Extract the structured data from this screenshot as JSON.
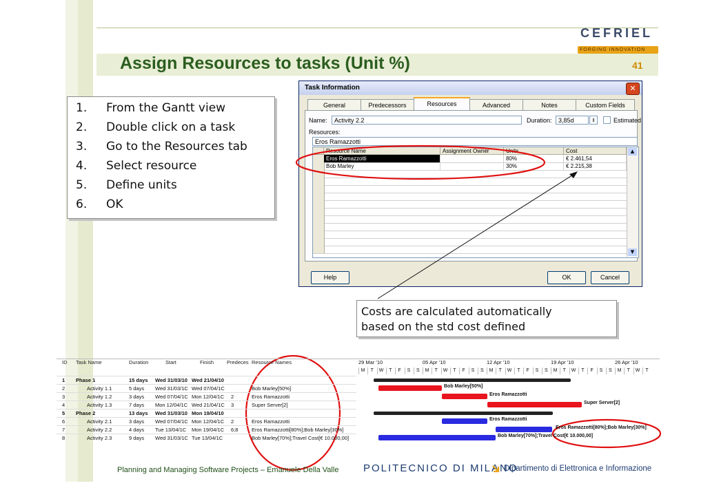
{
  "slide": {
    "title": "Assign Resources to tasks (Unit %)",
    "page_number": "41",
    "logo": {
      "name": "CEFRIEL",
      "tagline": "FORGING INNOVATION"
    },
    "footer": "Planning and Managing Software Projects – Emanuele Della Valle",
    "institution": "POLITECNICO DI MILANO",
    "department": "Dipartimento di Elettronica e Informazione"
  },
  "steps": [
    {
      "num": "1.",
      "text": "From the Gantt view"
    },
    {
      "num": "2.",
      "text": "Double click on a task"
    },
    {
      "num": "3.",
      "text": "Go to the Resources tab"
    },
    {
      "num": "4.",
      "text": "Select resource"
    },
    {
      "num": "5.",
      "text": "Define units"
    },
    {
      "num": "6.",
      "text": "OK"
    }
  ],
  "dialog": {
    "title": "Task Information",
    "close_glyph": "✕",
    "tabs": [
      "General",
      "Predecessors",
      "Resources",
      "Advanced",
      "Notes",
      "Custom Fields"
    ],
    "active_tab": "Resources",
    "name_label": "Name:",
    "name_value": "Activity 2.2",
    "duration_label": "Duration:",
    "duration_value": "3,85d",
    "estimated_label": "Estimated",
    "resources_label": "Resources:",
    "edit_value": "Eros Ramazzotti",
    "columns": [
      "Resource Name",
      "Assignment Owner",
      "Units",
      "Cost"
    ],
    "rows": [
      {
        "resource": "Eros Ramazzotti",
        "owner": "",
        "units": "80%",
        "cost": "€ 2.461,54"
      },
      {
        "resource": "Bob Marley",
        "owner": "",
        "units": "30%",
        "cost": "€ 2.215,38"
      }
    ],
    "help_label": "Help",
    "ok_label": "OK",
    "cancel_label": "Cancel"
  },
  "annotation": {
    "line1": "Costs are calculated automatically",
    "line2": "based on the std cost defined"
  },
  "gantt": {
    "headers": [
      "ID",
      "Task Name",
      "Duration",
      "Start",
      "Finish",
      "Predeces",
      "Resource Names"
    ],
    "weeks": [
      "29 Mar '10",
      "05 Apr '10",
      "12 Apr '10",
      "19 Apr '10",
      "26 Apr '10"
    ],
    "day_letters": [
      "M",
      "T",
      "W",
      "T",
      "F",
      "S",
      "S"
    ],
    "rows": [
      {
        "id": "1",
        "name": "Phase 1",
        "duration": "15 days",
        "start": "Wed 31/03/10",
        "finish": "Wed 21/04/10",
        "pred": "",
        "resources": ""
      },
      {
        "id": "2",
        "name": "Activity 1.1",
        "duration": "5 days",
        "start": "Wed 31/03/1C",
        "finish": "Wed 07/04/1C",
        "pred": "",
        "resources": "Bob Marley[50%]"
      },
      {
        "id": "3",
        "name": "Activity 1.2",
        "duration": "3 days",
        "start": "Wed 07/04/1C",
        "finish": "Mon 12/04/1C",
        "pred": "2",
        "resources": "Eros Ramazzotti"
      },
      {
        "id": "4",
        "name": "Activity 1.3",
        "duration": "7 days",
        "start": "Mon 12/04/1C",
        "finish": "Wed 21/04/1C",
        "pred": "3",
        "resources": "Super Server[2]"
      },
      {
        "id": "5",
        "name": "Phase 2",
        "duration": "13 days",
        "start": "Wed 31/03/10",
        "finish": "Mon 19/04/10",
        "pred": "",
        "resources": ""
      },
      {
        "id": "6",
        "name": "Activity 2.1",
        "duration": "3 days",
        "start": "Wed 07/04/1C",
        "finish": "Mon 12/04/1C",
        "pred": "2",
        "resources": "Eros Ramazzotti"
      },
      {
        "id": "7",
        "name": "Activity 2.2",
        "duration": "4 days",
        "start": "Tue 13/04/1C",
        "finish": "Mon 19/04/1C",
        "pred": "6;8",
        "resources": "Eros Ramazzotti[80%];Bob Marley[30%]"
      },
      {
        "id": "8",
        "name": "Activity 2.3",
        "duration": "9 days",
        "start": "Wed 31/03/1C",
        "finish": "Tue 13/04/1C",
        "pred": "",
        "resources": "Bob Marley[70%];Travel Cost[€ 10.000,00]"
      }
    ],
    "bar_labels": {
      "r2": "Bob Marley[50%]",
      "r3": "Eros Ramazzotti",
      "r4": "Super Server[2]",
      "r6": "Eros Ramazzotti",
      "r7": "Eros Ramazzotti[80%];Bob Marley[30%]",
      "r8": "Bob Marley[70%];Travel Cost[€ 10.000,00]"
    }
  },
  "colors": {
    "title": "#2b5d1f",
    "accent": "#d08a00",
    "red_bar": "#e8141e",
    "blue_bar": "#2a2ae0",
    "summary_bar": "#222222",
    "highlight": "#e01010"
  }
}
